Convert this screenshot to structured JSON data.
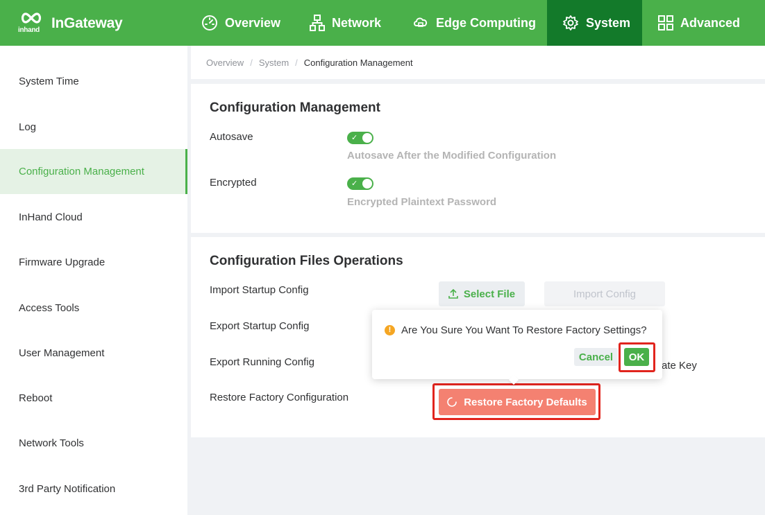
{
  "app": {
    "logo_small": "inhand",
    "logo_brand": "InGateway"
  },
  "nav": {
    "overview": "Overview",
    "network": "Network",
    "edge": "Edge Computing",
    "system": "System",
    "advanced": "Advanced"
  },
  "sidebar": {
    "items": [
      {
        "label": "System Time"
      },
      {
        "label": "Log"
      },
      {
        "label": "Configuration Management"
      },
      {
        "label": "InHand Cloud"
      },
      {
        "label": "Firmware Upgrade"
      },
      {
        "label": "Access Tools"
      },
      {
        "label": "User Management"
      },
      {
        "label": "Reboot"
      },
      {
        "label": "Network Tools"
      },
      {
        "label": "3rd Party Notification"
      }
    ],
    "active_index": 2
  },
  "breadcrumb": {
    "c1": "Overview",
    "c2": "System",
    "current": "Configuration Management",
    "sep": "/"
  },
  "config": {
    "title": "Configuration Management",
    "autosave_label": "Autosave",
    "autosave_hint": "Autosave After the Modified Configuration",
    "autosave_on": true,
    "encrypted_label": "Encrypted",
    "encrypted_hint": "Encrypted Plaintext Password",
    "encrypted_on": true
  },
  "files": {
    "title": "Configuration Files Operations",
    "import_label": "Import Startup Config",
    "export_startup_label": "Export Startup Config",
    "export_running_label": "Export Running Config",
    "restore_label": "Restore Factory Configuration",
    "select_file": "Select File",
    "import_config": "Import Config",
    "partial_text": "ate Key",
    "restore_button": "Restore Factory Defaults"
  },
  "popconfirm": {
    "message": "Are You Sure You Want To Restore Factory Settings?",
    "warn_glyph": "!",
    "cancel": "Cancel",
    "ok": "OK"
  },
  "colors": {
    "brand_green": "#4ab04a",
    "nav_active": "#137a2a",
    "danger": "#f48171",
    "highlight_red": "#e1241d",
    "warning": "#f5a623"
  }
}
